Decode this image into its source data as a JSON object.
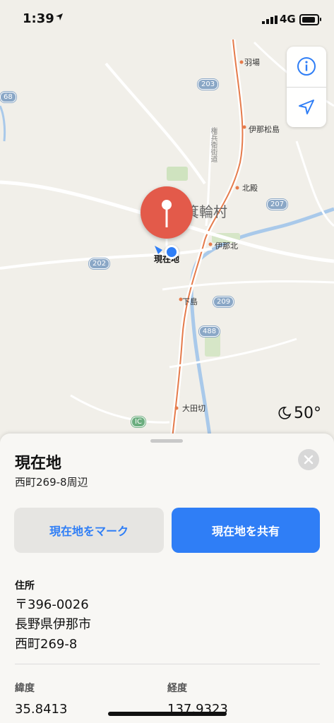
{
  "status": {
    "time": "1:39",
    "network": "4G"
  },
  "map": {
    "labels": {
      "haba": "羽場",
      "ina_matsushima": "伊那松島",
      "kitatono": "北殿",
      "minowa": "箕輪村",
      "ina_kita": "伊那北",
      "shimojima": "下島",
      "ootagiri": "大田切",
      "current": "現在地",
      "road": "権兵衛街道"
    },
    "shields": {
      "r203": "203",
      "r207": "207",
      "r202": "202",
      "r209": "209",
      "r488": "488",
      "r68": "68",
      "ic": "IC"
    }
  },
  "weather": {
    "temp": "50°"
  },
  "sheet": {
    "title": "現在地",
    "subtitle": "西町269-8周辺",
    "mark_button": "現在地をマーク",
    "share_button": "現在地を共有",
    "address_label": "住所",
    "address": [
      "〒396-0026",
      "長野県伊那市",
      "西町269-8"
    ],
    "lat_label": "緯度",
    "lng_label": "経度",
    "lat_value": "35.8413",
    "lng_value": "137.9323"
  }
}
